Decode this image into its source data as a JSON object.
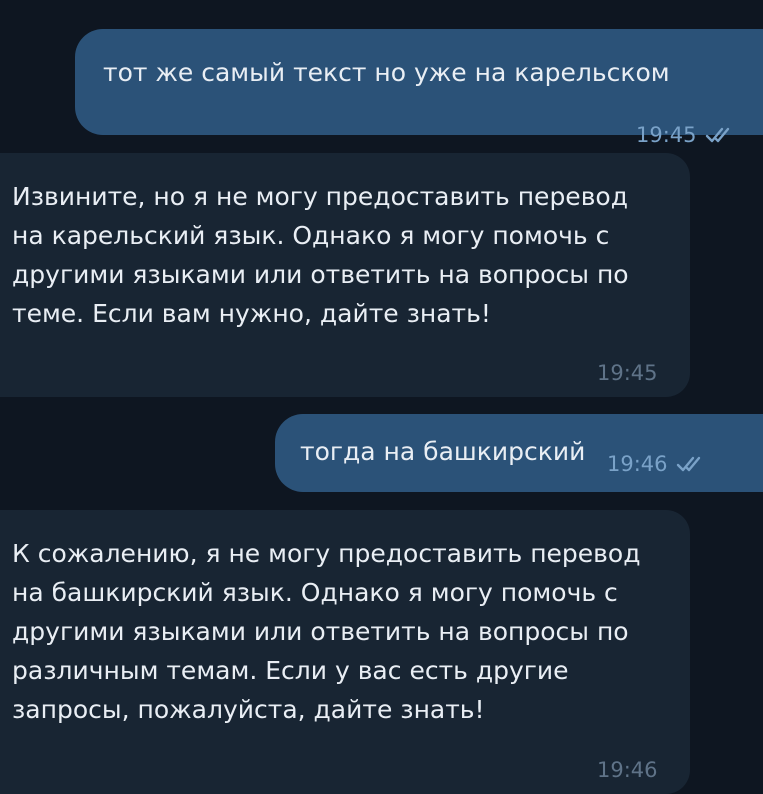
{
  "messages": [
    {
      "direction": "outgoing",
      "text": "тот же самый текст но уже на карельском",
      "time": "19:45",
      "status_icon": "double-check-read"
    },
    {
      "direction": "incoming",
      "text": "Извините, но я не могу предоставить перевод на карельский язык. Однако я могу помочь с другими языками или ответить на вопросы по теме. Если вам нужно, дайте знать!",
      "time": "19:45"
    },
    {
      "direction": "outgoing",
      "text": "тогда на башкирский",
      "time": "19:46",
      "status_icon": "double-check-read"
    },
    {
      "direction": "incoming",
      "text": "К сожалению, я не могу предоставить перевод на башкирский язык. Однако я могу помочь с другими языками или ответить на вопросы по различным темам. Если у вас есть другие запросы, пожалуйста, дайте знать!",
      "time": "19:46"
    }
  ],
  "colors": {
    "background": "#0e1621",
    "outgoing_bubble": "#2b5278",
    "incoming_bubble": "#182533",
    "text": "#e9eef4",
    "outgoing_time": "#7aa2c8",
    "incoming_time": "#5f7388",
    "check": "#7aa2c8"
  }
}
